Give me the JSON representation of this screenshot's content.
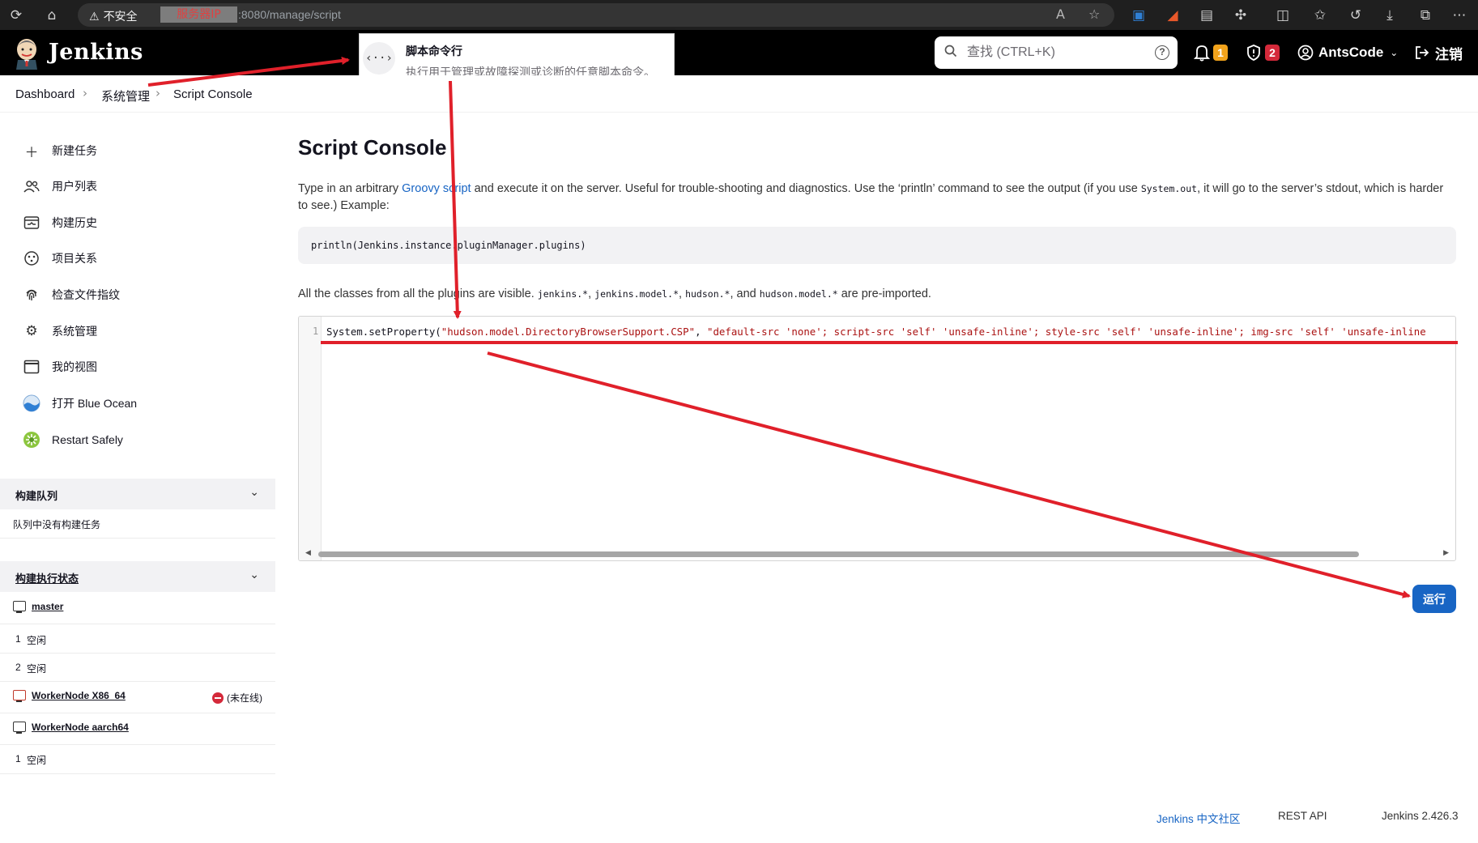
{
  "browser": {
    "insecure_label": "不安全",
    "url_redacted": "服务器IP",
    "url_suffix": ":8080/manage/script"
  },
  "header": {
    "brand": "Jenkins",
    "search_placeholder": "查找 (CTRL+K)",
    "notifications_count": "1",
    "security_count": "2",
    "user_name": "AntsCode",
    "logout_label": "注销",
    "colors": {
      "header_bg": "#000000",
      "notif_badge": "#f2a31b",
      "security_badge": "#d4293a"
    }
  },
  "popup": {
    "title": "脚本命令行",
    "description": "执行用于管理或故障探测或诊断的任意脚本命令。",
    "icon": "code-icon"
  },
  "breadcrumb": [
    "Dashboard",
    "系统管理",
    "Script Console"
  ],
  "sidebar": {
    "tasks": [
      {
        "label": "新建任务",
        "icon": "plus-icon"
      },
      {
        "label": "用户列表",
        "icon": "people-icon"
      },
      {
        "label": "构建历史",
        "icon": "history-icon"
      },
      {
        "label": "项目关系",
        "icon": "relationship-icon"
      },
      {
        "label": "检查文件指纹",
        "icon": "fingerprint-icon"
      },
      {
        "label": "系统管理",
        "icon": "gear-icon"
      },
      {
        "label": "我的视图",
        "icon": "window-icon"
      },
      {
        "label": "打开 Blue Ocean",
        "icon": "blue-ocean-icon"
      },
      {
        "label": "Restart Safely",
        "icon": "restart-icon"
      }
    ],
    "build_queue": {
      "title": "构建队列",
      "empty_text": "队列中没有构建任务"
    },
    "executors": {
      "title": "构建执行状态",
      "nodes": [
        {
          "name": "master",
          "executors": [
            {
              "num": "1",
              "status": "空闲"
            },
            {
              "num": "2",
              "status": "空闲"
            }
          ]
        },
        {
          "name": "WorkerNode X86_64",
          "offline_label": "(未在线)",
          "executors": []
        },
        {
          "name": "WorkerNode aarch64",
          "executors": [
            {
              "num": "1",
              "status": "空闲"
            }
          ]
        }
      ]
    }
  },
  "main": {
    "title": "Script Console",
    "desc_part1": "Type in an arbitrary ",
    "desc_link": "Groovy script",
    "desc_part2": " and execute it on the server. Useful for trouble-shooting and diagnostics. Use the ‘println’ command to see the output (if you use ",
    "desc_code": "System.out",
    "desc_part3": ", it will go to the server’s stdout, which is harder to see.) Example:",
    "example": "println(Jenkins.instance.pluginManager.plugins)",
    "imports_part1": "All the classes from all the plugins are visible. ",
    "imports_code1": "jenkins.*",
    "imports_code2": "jenkins.model.*",
    "imports_code3": "hudson.*",
    "imports_sep1": ", ",
    "imports_sep2": ", ",
    "imports_sep3": ", and ",
    "imports_code4": "hudson.model.*",
    "imports_part2": " are pre-imported.",
    "editor": {
      "line_number": "1",
      "code_prefix": "System.setProperty(",
      "code_str1": "\"hudson.model.DirectoryBrowserSupport.CSP\"",
      "code_sep": ", ",
      "code_str2": "\"default-src 'none'; script-src 'self' 'unsafe-inline'; style-src 'self' 'unsafe-inline'; img-src 'self' 'unsafe-inline"
    },
    "run_label": "运行"
  },
  "footer": {
    "community": "Jenkins 中文社区",
    "rest_api": "REST API",
    "version": "Jenkins 2.426.3"
  }
}
